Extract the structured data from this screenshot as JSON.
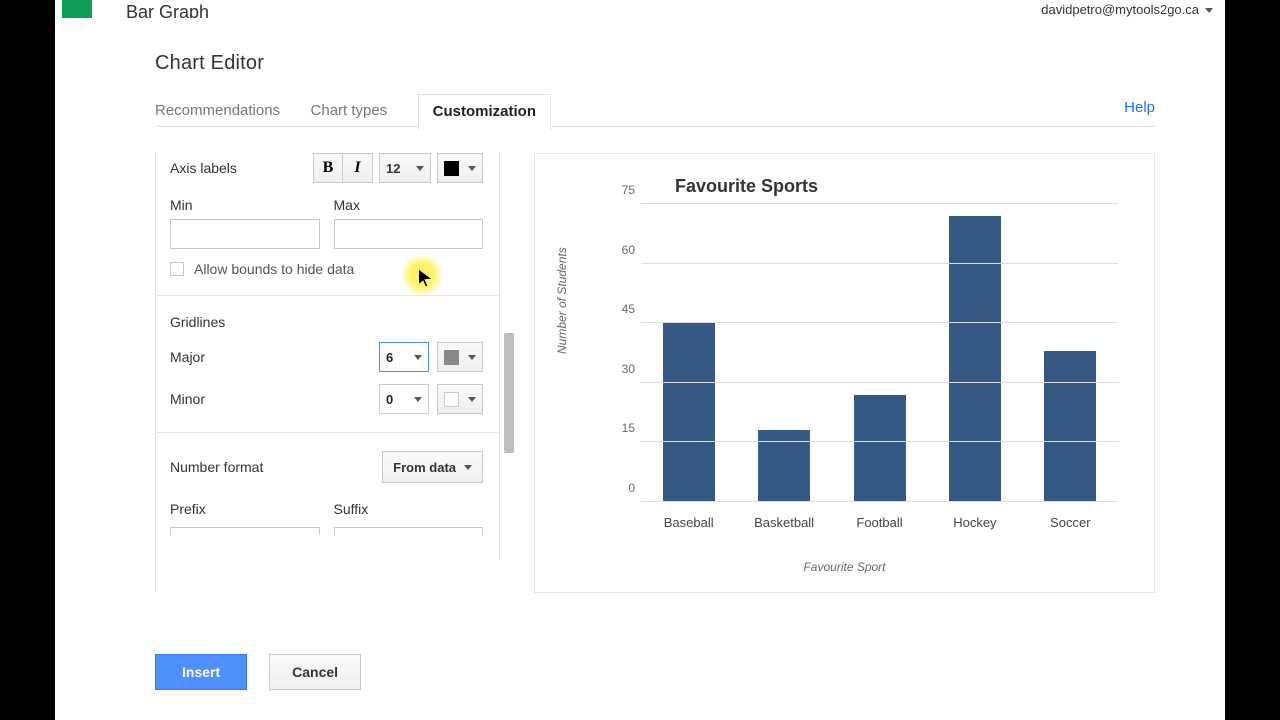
{
  "sheets": {
    "doc_title": "Bar Graph",
    "user_email": "davidpetro@mytools2go.ca"
  },
  "dialog": {
    "title": "Chart Editor",
    "tabs": {
      "recommendations": "Recommendations",
      "chart_types": "Chart types",
      "customization": "Customization"
    },
    "help": "Help"
  },
  "axis_labels": {
    "heading": "Axis labels",
    "font_size": "12",
    "min_label": "Min",
    "min_value": "",
    "max_label": "Max",
    "max_value": "",
    "allow_bounds": "Allow bounds to hide data"
  },
  "gridlines": {
    "heading": "Gridlines",
    "major_label": "Major",
    "major_value": "6",
    "minor_label": "Minor",
    "minor_value": "0"
  },
  "number_format": {
    "heading": "Number format",
    "source": "From data",
    "prefix_label": "Prefix",
    "prefix_value": "",
    "suffix_label": "Suffix",
    "suffix_value": ""
  },
  "footer": {
    "insert": "Insert",
    "cancel": "Cancel"
  },
  "chart_data": {
    "type": "bar",
    "title": "Favourite Sports",
    "xlabel": "Favourite Sport",
    "ylabel": "Number of Students",
    "ylim": [
      0,
      75
    ],
    "y_ticks": [
      0,
      15,
      30,
      45,
      60,
      75
    ],
    "categories": [
      "Baseball",
      "Basketball",
      "Football",
      "Hockey",
      "Soccer"
    ],
    "values": [
      45,
      18,
      27,
      72,
      38
    ]
  }
}
